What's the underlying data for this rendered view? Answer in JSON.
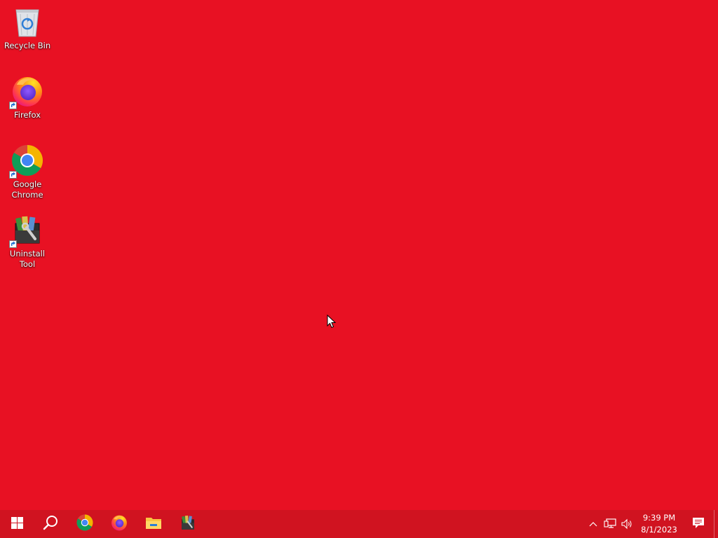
{
  "desktop": {
    "background_color": "#e81123",
    "icons": [
      {
        "label": "Recycle Bin",
        "icon": "recycle-bin-icon",
        "shortcut": false
      },
      {
        "label": "Firefox",
        "icon": "firefox-icon",
        "shortcut": true
      },
      {
        "label": "Google Chrome",
        "icon": "chrome-icon",
        "shortcut": true
      },
      {
        "label": "Uninstall Tool",
        "icon": "uninstall-tool-icon",
        "shortcut": true
      }
    ]
  },
  "taskbar": {
    "background_color": "#d01320",
    "buttons": [
      {
        "name": "start",
        "icon": "windows-logo-icon"
      },
      {
        "name": "search",
        "icon": "search-icon"
      }
    ],
    "pinned_apps": [
      {
        "name": "Google Chrome",
        "icon": "chrome-icon"
      },
      {
        "name": "Firefox",
        "icon": "firefox-icon"
      },
      {
        "name": "File Explorer",
        "icon": "folder-icon"
      },
      {
        "name": "Uninstall Tool",
        "icon": "uninstall-tool-icon"
      }
    ],
    "tray": {
      "icons": [
        "chevron-up-icon",
        "network-icon",
        "volume-icon"
      ],
      "time": "9:39 PM",
      "date": "8/1/2023",
      "notification_icon": "notification-icon"
    }
  }
}
